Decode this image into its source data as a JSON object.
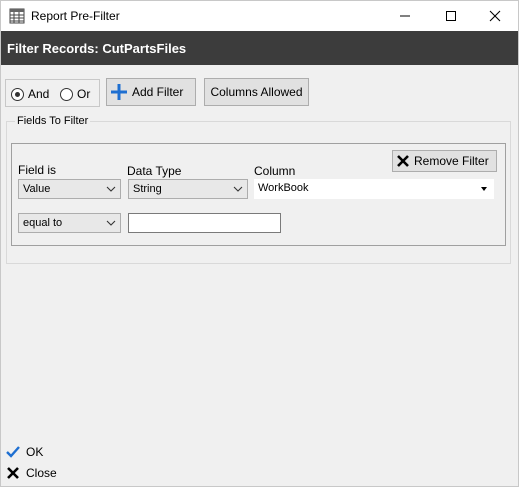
{
  "window": {
    "title": "Report Pre-Filter",
    "icon": "table-icon"
  },
  "header": {
    "title": "Filter Records: CutPartsFiles"
  },
  "toolbar": {
    "logic": {
      "and_label": "And",
      "or_label": "Or",
      "selected": "And"
    },
    "add_filter_label": "Add Filter",
    "columns_allowed_label": "Columns Allowed"
  },
  "fields": {
    "group_label": "Fields To Filter",
    "filter": {
      "field_is_label": "Field is",
      "field_is_value": "Value",
      "data_type_label": "Data Type",
      "data_type_value": "String",
      "column_label": "Column",
      "column_value": "WorkBook",
      "remove_label": "Remove Filter",
      "operator_value": "equal to",
      "criteria_value": ""
    }
  },
  "footer": {
    "ok_label": "OK",
    "close_label": "Close"
  },
  "colors": {
    "header_bg": "#3c3c3c",
    "accent_blue": "#1e6fd1"
  }
}
